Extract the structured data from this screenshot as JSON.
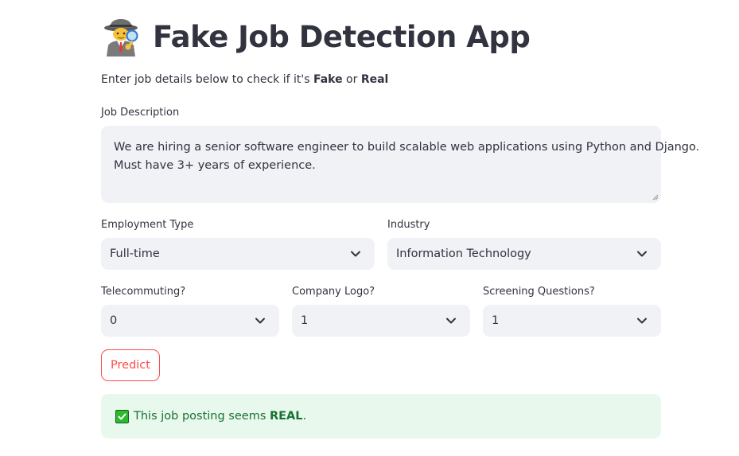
{
  "header": {
    "icon": "detective-icon",
    "title": "Fake Job Detection App"
  },
  "intro": {
    "prefix": "Enter job details below to check if it's ",
    "fake": "Fake",
    "or": " or ",
    "real": "Real"
  },
  "form": {
    "job_description": {
      "label": "Job Description",
      "value_line1": "We are hiring a senior software engineer to build scalable web applications using Python and Django.",
      "value_line2": "Must have 3+ years of experience."
    },
    "employment_type": {
      "label": "Employment Type",
      "value": "Full-time"
    },
    "industry": {
      "label": "Industry",
      "value": "Information Technology"
    },
    "telecommuting": {
      "label": "Telecommuting?",
      "value": "0"
    },
    "company_logo": {
      "label": "Company Logo?",
      "value": "1"
    },
    "screening_questions": {
      "label": "Screening Questions?",
      "value": "1"
    },
    "predict_label": "Predict"
  },
  "result": {
    "icon": "check-mark-icon",
    "prefix": "This job posting seems ",
    "verdict": "REAL",
    "suffix": "."
  },
  "colors": {
    "primary": "#ff4b4b",
    "input_bg": "#f0f2f6",
    "success_bg": "#e9f8ec",
    "success_text": "#177233",
    "text": "#31333f"
  }
}
